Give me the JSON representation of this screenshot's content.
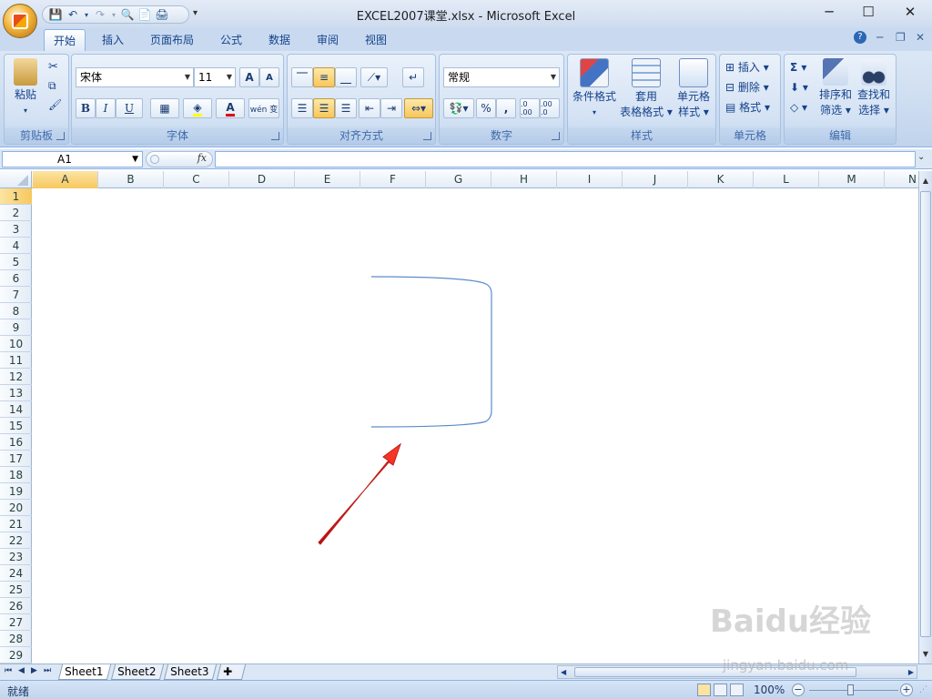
{
  "window": {
    "title": "EXCEL2007课堂.xlsx - Microsoft Excel",
    "minimize": "─",
    "maximize": "☐",
    "close": "✕"
  },
  "qat": {
    "icons": [
      "save-icon",
      "undo-icon",
      "redo-icon",
      "print-preview-icon",
      "new-icon",
      "print-icon"
    ],
    "customize": "▾"
  },
  "tabs": [
    "开始",
    "插入",
    "页面布局",
    "公式",
    "数据",
    "审阅",
    "视图"
  ],
  "active_tab": "开始",
  "ribbon": {
    "clipboard": {
      "title": "剪贴板",
      "paste": "粘贴"
    },
    "font": {
      "title": "字体",
      "name": "宋体",
      "size": "11",
      "grow": "A",
      "shrink": "A",
      "bold": "B",
      "italic": "I",
      "underline": "U",
      "font_color": "A",
      "phonetic": "wén 变"
    },
    "alignment": {
      "title": "对齐方式"
    },
    "number": {
      "title": "数字",
      "format": "常规",
      "percent": "%",
      "comma": ",",
      "inc_decimal": ".0 .00",
      "dec_decimal": ".00 .0"
    },
    "styles": {
      "title": "样式",
      "conditional": "条件格式",
      "table1": "套用",
      "table2": "表格格式",
      "cell1": "单元格",
      "cell2": "样式"
    },
    "cells": {
      "title": "单元格",
      "insert": "插入",
      "delete": "删除",
      "format": "格式"
    },
    "editing": {
      "title": "编辑",
      "sum": "Σ",
      "sort1": "排序和",
      "sort2": "筛选",
      "find1": "查找和",
      "find2": "选择"
    }
  },
  "formula_bar": {
    "name_box": "A1",
    "fx": "fx",
    "formula": ""
  },
  "columns": [
    "A",
    "B",
    "C",
    "D",
    "E",
    "F",
    "G",
    "H",
    "I",
    "J",
    "K",
    "L",
    "M",
    "N"
  ],
  "rows": [
    "1",
    "2",
    "3",
    "4",
    "5",
    "6",
    "7",
    "8",
    "9",
    "10",
    "11",
    "12",
    "13",
    "14",
    "15",
    "16",
    "17",
    "18",
    "19",
    "20",
    "21",
    "22",
    "23",
    "24",
    "25",
    "26",
    "27",
    "28",
    "29"
  ],
  "sheets": [
    "Sheet1",
    "Sheet2",
    "Sheet3"
  ],
  "status": {
    "text": "就绪",
    "zoom": "100%",
    "zoom_out": "−",
    "zoom_in": "+"
  },
  "watermark": {
    "logo": "Baidu经验",
    "url": "jingyan.baidu.com"
  },
  "colors": {
    "accent": "#15428b",
    "ribbon_bg": "#c9daf0",
    "highlight": "#f8c65a",
    "annotation_arrow": "#e0201c",
    "shape_line": "#5b8cc6"
  }
}
